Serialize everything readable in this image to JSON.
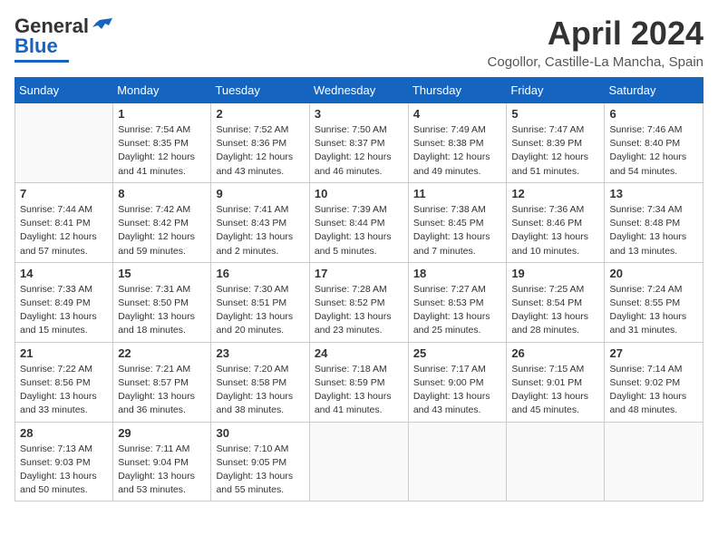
{
  "header": {
    "logo_general": "General",
    "logo_blue": "Blue",
    "title": "April 2024",
    "location": "Cogollor, Castille-La Mancha, Spain"
  },
  "days_of_week": [
    "Sunday",
    "Monday",
    "Tuesday",
    "Wednesday",
    "Thursday",
    "Friday",
    "Saturday"
  ],
  "weeks": [
    [
      {
        "day": null
      },
      {
        "day": "1",
        "sunrise": "7:54 AM",
        "sunset": "8:35 PM",
        "daylight": "12 hours and 41 minutes."
      },
      {
        "day": "2",
        "sunrise": "7:52 AM",
        "sunset": "8:36 PM",
        "daylight": "12 hours and 43 minutes."
      },
      {
        "day": "3",
        "sunrise": "7:50 AM",
        "sunset": "8:37 PM",
        "daylight": "12 hours and 46 minutes."
      },
      {
        "day": "4",
        "sunrise": "7:49 AM",
        "sunset": "8:38 PM",
        "daylight": "12 hours and 49 minutes."
      },
      {
        "day": "5",
        "sunrise": "7:47 AM",
        "sunset": "8:39 PM",
        "daylight": "12 hours and 51 minutes."
      },
      {
        "day": "6",
        "sunrise": "7:46 AM",
        "sunset": "8:40 PM",
        "daylight": "12 hours and 54 minutes."
      }
    ],
    [
      {
        "day": "7",
        "sunrise": "7:44 AM",
        "sunset": "8:41 PM",
        "daylight": "12 hours and 57 minutes."
      },
      {
        "day": "8",
        "sunrise": "7:42 AM",
        "sunset": "8:42 PM",
        "daylight": "12 hours and 59 minutes."
      },
      {
        "day": "9",
        "sunrise": "7:41 AM",
        "sunset": "8:43 PM",
        "daylight": "13 hours and 2 minutes."
      },
      {
        "day": "10",
        "sunrise": "7:39 AM",
        "sunset": "8:44 PM",
        "daylight": "13 hours and 5 minutes."
      },
      {
        "day": "11",
        "sunrise": "7:38 AM",
        "sunset": "8:45 PM",
        "daylight": "13 hours and 7 minutes."
      },
      {
        "day": "12",
        "sunrise": "7:36 AM",
        "sunset": "8:46 PM",
        "daylight": "13 hours and 10 minutes."
      },
      {
        "day": "13",
        "sunrise": "7:34 AM",
        "sunset": "8:48 PM",
        "daylight": "13 hours and 13 minutes."
      }
    ],
    [
      {
        "day": "14",
        "sunrise": "7:33 AM",
        "sunset": "8:49 PM",
        "daylight": "13 hours and 15 minutes."
      },
      {
        "day": "15",
        "sunrise": "7:31 AM",
        "sunset": "8:50 PM",
        "daylight": "13 hours and 18 minutes."
      },
      {
        "day": "16",
        "sunrise": "7:30 AM",
        "sunset": "8:51 PM",
        "daylight": "13 hours and 20 minutes."
      },
      {
        "day": "17",
        "sunrise": "7:28 AM",
        "sunset": "8:52 PM",
        "daylight": "13 hours and 23 minutes."
      },
      {
        "day": "18",
        "sunrise": "7:27 AM",
        "sunset": "8:53 PM",
        "daylight": "13 hours and 25 minutes."
      },
      {
        "day": "19",
        "sunrise": "7:25 AM",
        "sunset": "8:54 PM",
        "daylight": "13 hours and 28 minutes."
      },
      {
        "day": "20",
        "sunrise": "7:24 AM",
        "sunset": "8:55 PM",
        "daylight": "13 hours and 31 minutes."
      }
    ],
    [
      {
        "day": "21",
        "sunrise": "7:22 AM",
        "sunset": "8:56 PM",
        "daylight": "13 hours and 33 minutes."
      },
      {
        "day": "22",
        "sunrise": "7:21 AM",
        "sunset": "8:57 PM",
        "daylight": "13 hours and 36 minutes."
      },
      {
        "day": "23",
        "sunrise": "7:20 AM",
        "sunset": "8:58 PM",
        "daylight": "13 hours and 38 minutes."
      },
      {
        "day": "24",
        "sunrise": "7:18 AM",
        "sunset": "8:59 PM",
        "daylight": "13 hours and 41 minutes."
      },
      {
        "day": "25",
        "sunrise": "7:17 AM",
        "sunset": "9:00 PM",
        "daylight": "13 hours and 43 minutes."
      },
      {
        "day": "26",
        "sunrise": "7:15 AM",
        "sunset": "9:01 PM",
        "daylight": "13 hours and 45 minutes."
      },
      {
        "day": "27",
        "sunrise": "7:14 AM",
        "sunset": "9:02 PM",
        "daylight": "13 hours and 48 minutes."
      }
    ],
    [
      {
        "day": "28",
        "sunrise": "7:13 AM",
        "sunset": "9:03 PM",
        "daylight": "13 hours and 50 minutes."
      },
      {
        "day": "29",
        "sunrise": "7:11 AM",
        "sunset": "9:04 PM",
        "daylight": "13 hours and 53 minutes."
      },
      {
        "day": "30",
        "sunrise": "7:10 AM",
        "sunset": "9:05 PM",
        "daylight": "13 hours and 55 minutes."
      },
      {
        "day": null
      },
      {
        "day": null
      },
      {
        "day": null
      },
      {
        "day": null
      }
    ]
  ],
  "labels": {
    "sunrise": "Sunrise:",
    "sunset": "Sunset:",
    "daylight": "Daylight:"
  }
}
